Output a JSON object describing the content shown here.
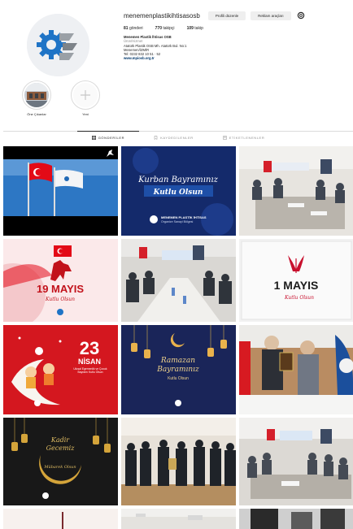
{
  "profile": {
    "username": "menemenplastikihtisasosb",
    "edit_label": "Profili düzenle",
    "archive_label": "Reklam araçları",
    "posts_count": "81",
    "posts_label": "gönderi",
    "followers_count": "770",
    "followers_label": "takipçi",
    "following_count": "109",
    "following_label": "takip",
    "bio_name": "Menemen Plastik İhtisas OSB",
    "bio_category": "Ürün/Hizmet",
    "bio_line1": "Atatürk Plastik OSB Mh. Atatürk Bul. No:1",
    "bio_line2": "Menemen/İZMİR",
    "bio_phone": "Tel: 0232 832 10 51 · 52",
    "bio_link": "www.mpiosb.org.tr"
  },
  "highlights": [
    {
      "label": "Öne Çıkanlar"
    },
    {
      "label": "Yeni"
    }
  ],
  "tabs": [
    {
      "label": "GÖNDERİLER",
      "active": true
    },
    {
      "label": "KAYDEDİLENLER",
      "active": false
    },
    {
      "label": "ETİKETLENENLER",
      "active": false
    }
  ],
  "posts": {
    "p2_line1": "Kurban Bayramınız",
    "p2_line2": "Kutlu Olsun",
    "p2_org": "MENEMEN PLASTİK İHTİSAS",
    "p2_org2": "Organize Sanayi Bölgesi",
    "p4_big": "19 MAYIS",
    "p4_small": "Kutlu Olsun",
    "p6_big": "1 MAYIS",
    "p6_small": "Kutlu Olsun",
    "p7_num": "23",
    "p7_word": "NİSAN",
    "p7_sub": "Ulusal Egemenlik ve Çocuk Bayramı Kutlu Olsun",
    "p8_line1": "Ramazan",
    "p8_line2": "Bayramınız",
    "p8_line3": "Kutlu Olsun",
    "p10_line1": "Kadir",
    "p10_line2": "Gecemiz",
    "p10_line3": "Mübarek Olsun"
  },
  "colors": {
    "text": "#262626",
    "muted": "#8e8e8e",
    "link": "#00376b",
    "border": "#dbdbdb",
    "button": "#efefef",
    "turkish_red": "#e30a17",
    "navy": "#142a6b",
    "gold": "#d7ae4a"
  }
}
